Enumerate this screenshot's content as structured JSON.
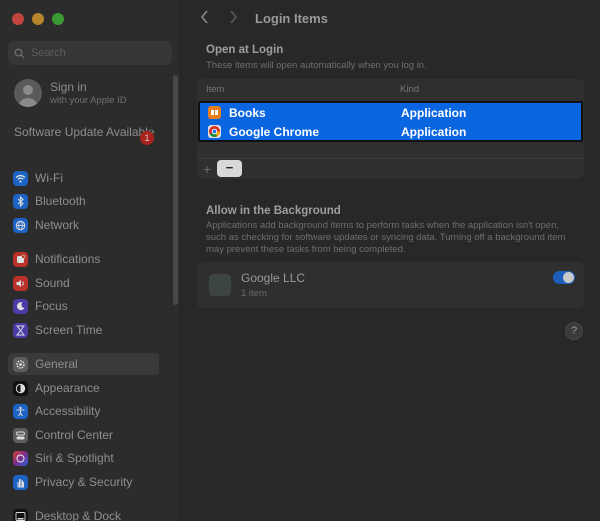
{
  "window": {
    "traffic_lights": [
      "#c0463e",
      "#b8862a",
      "#3c9a35"
    ]
  },
  "sidebar": {
    "search": {
      "placeholder": "Search",
      "value": ""
    },
    "account": {
      "title": "Sign in",
      "subtitle": "with your Apple ID"
    },
    "software_update": {
      "label": "Software Update Available",
      "badge": "1"
    },
    "items": [
      {
        "label": "Wi-Fi",
        "icon": "wifi-icon",
        "color": "#1d63c4"
      },
      {
        "label": "Bluetooth",
        "icon": "bluetooth-icon",
        "color": "#1d63c4"
      },
      {
        "label": "Network",
        "icon": "globe-icon",
        "color": "#1d63c4"
      },
      {
        "label": "Notifications",
        "icon": "bell-icon",
        "color": "#b8322b"
      },
      {
        "label": "Sound",
        "icon": "speaker-icon",
        "color": "#b8322b"
      },
      {
        "label": "Focus",
        "icon": "moon-icon",
        "color": "#4b3da8"
      },
      {
        "label": "Screen Time",
        "icon": "hourglass-icon",
        "color": "#4b3da8"
      },
      {
        "label": "General",
        "icon": "gear-icon",
        "color": "#5d5d5d",
        "selected": true
      },
      {
        "label": "Appearance",
        "icon": "appearance-icon",
        "color": "#111111"
      },
      {
        "label": "Accessibility",
        "icon": "accessibility-icon",
        "color": "#1d63c4"
      },
      {
        "label": "Control Center",
        "icon": "control-center-icon",
        "color": "#5d5d5d"
      },
      {
        "label": "Siri & Spotlight",
        "icon": "siri-icon",
        "color": "#7a2d8c"
      },
      {
        "label": "Privacy & Security",
        "icon": "hand-icon",
        "color": "#1d63c4"
      },
      {
        "label": "Desktop & Dock",
        "icon": "dock-icon",
        "color": "#111111"
      }
    ]
  },
  "main": {
    "title": "Login Items",
    "open_at_login": {
      "heading": "Open at Login",
      "description": "These items will open automatically when you log in.",
      "columns": {
        "item": "Item",
        "kind": "Kind"
      },
      "rows": [
        {
          "name": "Books",
          "kind": "Application",
          "icon": "books-icon",
          "color": "#e8801a"
        },
        {
          "name": "Google Chrome",
          "kind": "Application",
          "icon": "chrome-icon",
          "color": "#e0e0e0"
        }
      ],
      "add_label": "+",
      "remove_label": "−"
    },
    "background": {
      "heading": "Allow in the Background",
      "description": "Applications add background items to perform tasks when the application isn't open, such as checking for software updates or syncing data. Turning off a background item may prevent these tasks from being completed.",
      "items": [
        {
          "name": "Google LLC",
          "count": "1 item",
          "enabled": true
        }
      ]
    },
    "help_label": "?"
  }
}
